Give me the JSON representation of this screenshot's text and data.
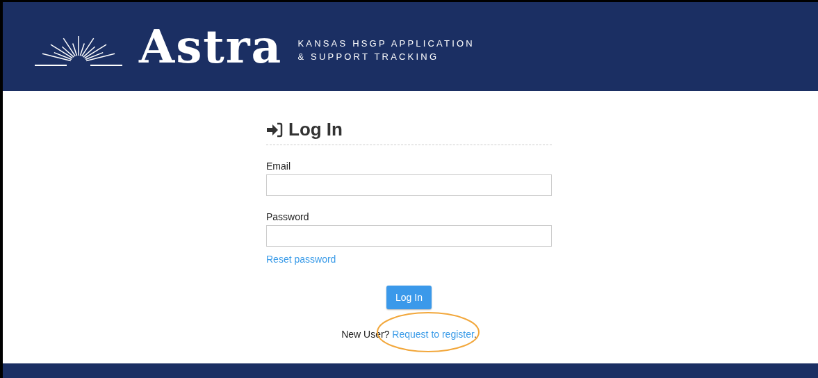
{
  "header": {
    "logo": "Astra",
    "tagline_lines": [
      "KANSAS HSGP APPLICATION",
      "& SUPPORT TRACKING"
    ]
  },
  "login": {
    "title": "Log In",
    "fields": [
      {
        "label": "Email"
      },
      {
        "label": "Password"
      }
    ],
    "reset_link": "Reset password",
    "submit": "Log In",
    "register": {
      "prefix": "New User?",
      "link": "Request to register",
      "suffix": ".",
      "highlighted": true
    }
  }
}
